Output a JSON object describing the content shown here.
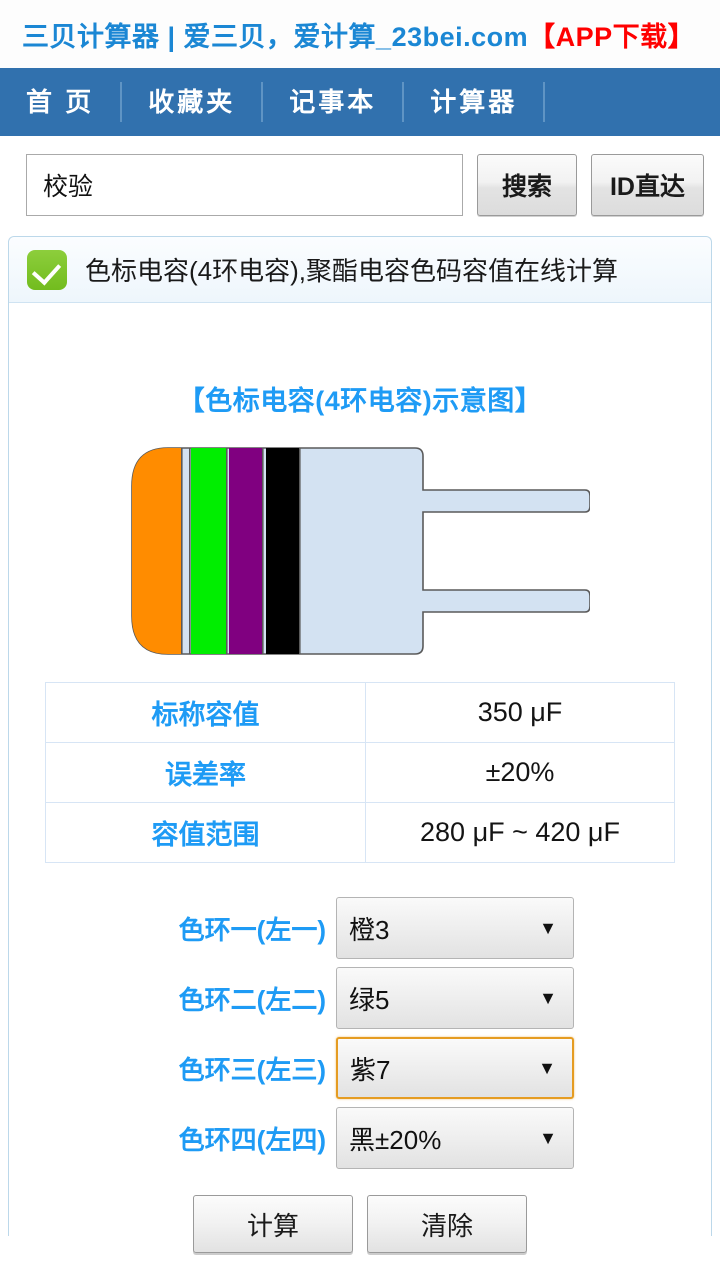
{
  "site": {
    "title_blue": "三贝计算器 | 爱三贝，爱计算_23bei.com",
    "title_red": "【APP下载】"
  },
  "nav": {
    "items": [
      {
        "label": "首  页",
        "name": "nav-home"
      },
      {
        "label": "收藏夹",
        "name": "nav-favorites"
      },
      {
        "label": "记事本",
        "name": "nav-notepad"
      },
      {
        "label": "计算器",
        "name": "nav-calculator"
      }
    ]
  },
  "search": {
    "value": "校验",
    "placeholder": "校验",
    "search_button": "搜索",
    "id_button": "ID直达"
  },
  "panel": {
    "check_icon": "check-icon",
    "heading": "色标电容(4环电容),聚酯电容色码容值在线计算",
    "diagram_title": "【色标电容(4环电容)示意图】"
  },
  "diagram": {
    "body_color": "#d3e2f2",
    "outline_color": "#5a5a5a",
    "bands": [
      {
        "name": "band-1",
        "color": "#ff8c00"
      },
      {
        "name": "band-2",
        "color": "#00ee00"
      },
      {
        "name": "band-3",
        "color": "#800080"
      },
      {
        "name": "band-4",
        "color": "#000000"
      }
    ]
  },
  "results": {
    "rows": [
      {
        "label": "标称容值",
        "value": "350 μF"
      },
      {
        "label": "误差率",
        "value": "±20%"
      },
      {
        "label": "容值范围",
        "value": "280 μF ~ 420 μF"
      }
    ]
  },
  "selects": [
    {
      "label": "色环一(左一)",
      "value": "橙3",
      "focused": false
    },
    {
      "label": "色环二(左二)",
      "value": "绿5",
      "focused": false
    },
    {
      "label": "色环三(左三)",
      "value": "紫7",
      "focused": true
    },
    {
      "label": "色环四(左四)",
      "value": "黑±20%",
      "focused": false
    }
  ],
  "select_arrow": "▼",
  "actions": {
    "calculate": "计算",
    "clear": "清除"
  },
  "colors": {
    "nav_blue": "#3171ae",
    "accent_blue": "#1e9bf5",
    "title_blue": "#1b87d4",
    "red": "#ff0000",
    "focus_orange": "#e59c22"
  }
}
